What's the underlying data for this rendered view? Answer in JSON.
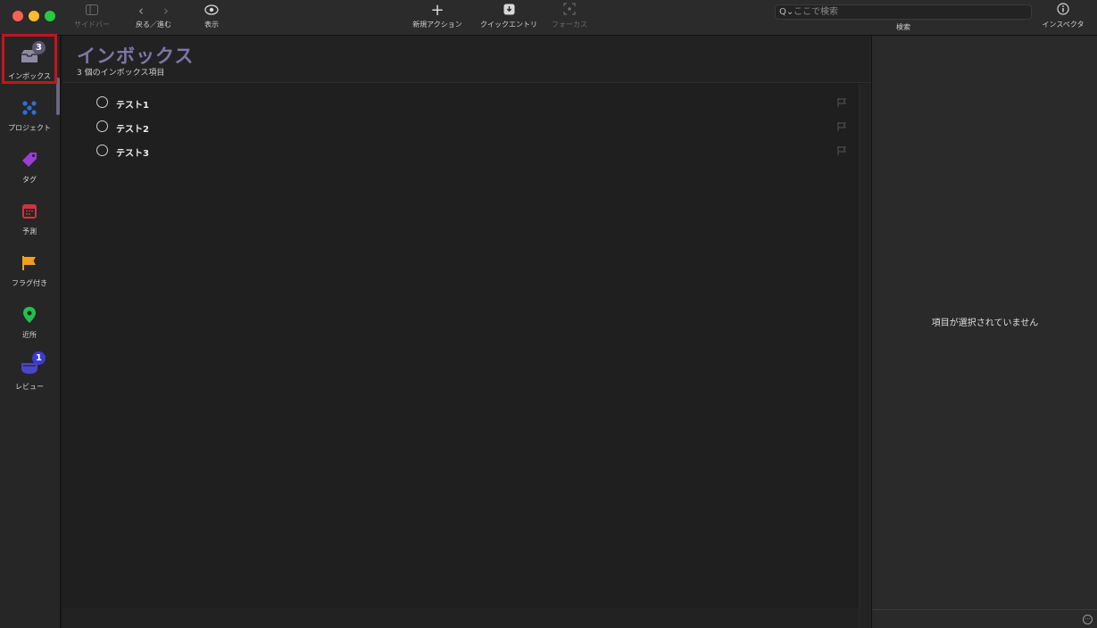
{
  "toolbar": {
    "sidebar_label": "サイドバー",
    "back_forward_label": "戻る／進む",
    "view_label": "表示",
    "new_action_label": "新規アクション",
    "quick_entry_label": "クイックエントリ",
    "focus_label": "フォーカス",
    "search_placeholder": "ここで検索",
    "search_label": "検索",
    "inspector_label": "インスペクタ"
  },
  "sidebar": {
    "items": [
      {
        "label": "インボックス",
        "badge": "3",
        "icon": "inbox-icon",
        "color": "#8e8aa3",
        "selected": true
      },
      {
        "label": "プロジェクト",
        "icon": "projects-icon",
        "color": "#2f6fd6"
      },
      {
        "label": "タグ",
        "icon": "tag-icon",
        "color": "#9a3ed6"
      },
      {
        "label": "予測",
        "icon": "forecast-icon",
        "color": "#d6323b"
      },
      {
        "label": "フラグ付き",
        "icon": "flag-icon",
        "color": "#f0a020"
      },
      {
        "label": "近所",
        "icon": "nearby-pin-icon",
        "color": "#22c04a"
      },
      {
        "label": "レビュー",
        "badge": "1",
        "icon": "review-icon",
        "color": "#4a46c8"
      }
    ]
  },
  "main": {
    "title": "インボックス",
    "subtitle": "3 個のインボックス項目",
    "tasks": [
      {
        "title": "テスト1"
      },
      {
        "title": "テスト2"
      },
      {
        "title": "テスト3"
      }
    ]
  },
  "inspector": {
    "empty_text": "項目が選択されていません"
  },
  "colors": {
    "title_accent": "#7d76a8",
    "selection_outline": "#c4141c"
  }
}
